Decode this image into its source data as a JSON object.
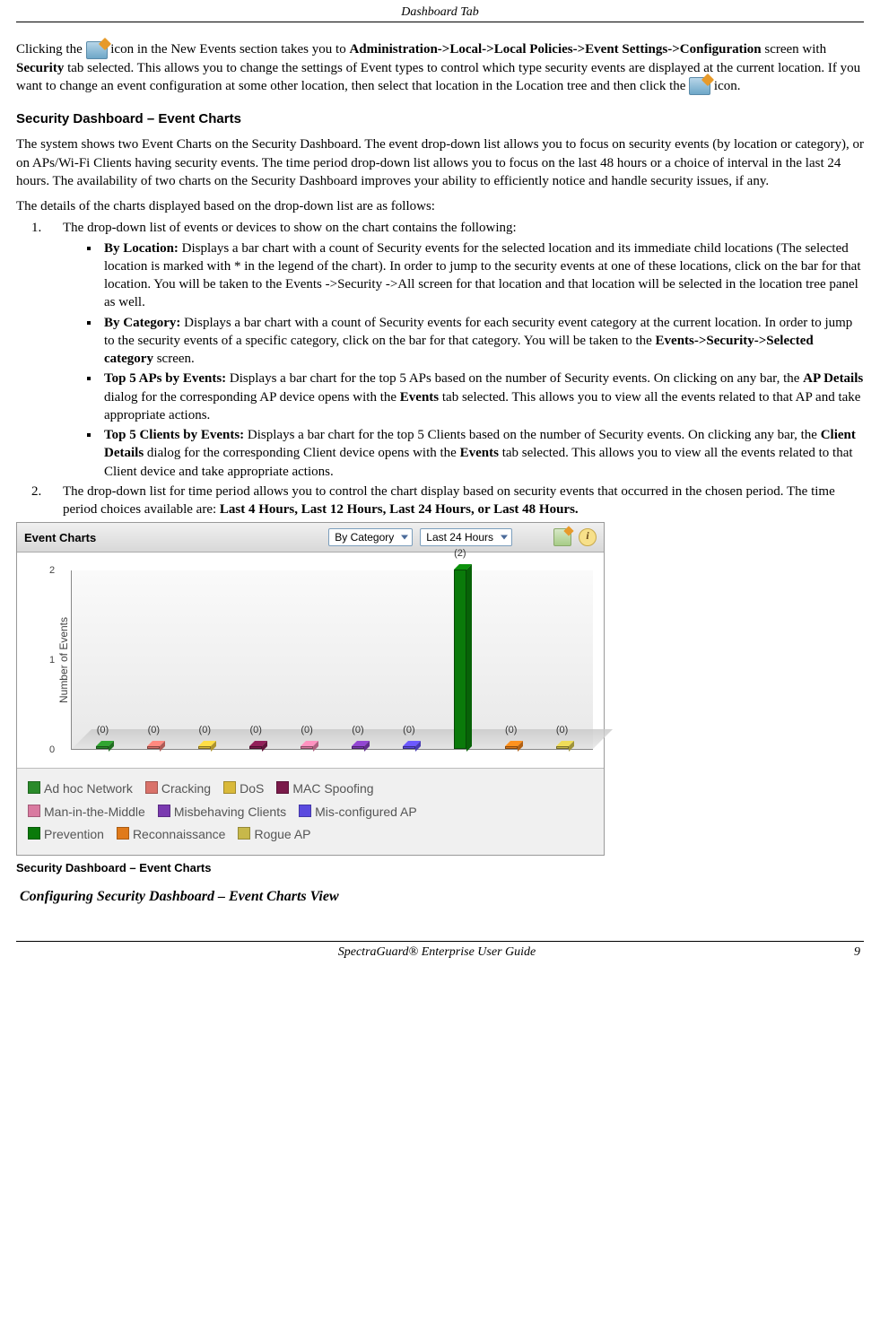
{
  "header": {
    "title": "Dashboard Tab"
  },
  "para1": {
    "lead": "Clicking the ",
    "icon_name": "locate-edit-icon",
    "after_icon": " icon in the New Events section takes you to ",
    "bold_path": "Administration->Local->Local Policies->Event Settings->Configuration",
    "mid1": " screen with ",
    "bold_security": "Security",
    "mid2": " tab selected. This allows you to change the settings of Event types to control which type security events are displayed at the current location. If you want to change an event configuration at some other location, then select that location in the Location tree and then click the ",
    "tail": " icon."
  },
  "section1_heading": "Security Dashboard – Event Charts",
  "para2": "The system shows two Event Charts on the Security Dashboard. The event drop-down list allows you to focus on security events (by location or category), or on APs/Wi-Fi Clients having security events. The time period drop-down list allows you to focus on the last 48 hours or a choice of interval in the last 24 hours. The availability of two charts on the Security Dashboard improves your ability to efficiently notice and handle security issues, if any.",
  "para3": "The details of the charts displayed based on the drop-down list are as follows:",
  "list1_item1": "The drop-down list of events or devices to show on the chart contains the following:",
  "bullets": [
    {
      "title": "By Location:",
      "text": " Displays a bar chart with a count of Security events for the selected location and its immediate child locations (The selected location is marked with * in the legend of the chart). In order to jump to the security events at one of these locations, click on the bar for that location. You will be taken to the Events ->Security ->All screen for that location and that location will be selected in the location tree panel as well."
    },
    {
      "title": "By Category:",
      "text_pre": " Displays a bar chart with a count of Security events for each security event category at the current location. In order to jump to the security events of a specific category, click on the bar for that category. You will be taken to the ",
      "bold1": "Events->Security->Selected category",
      "text_post": " screen."
    },
    {
      "title": "Top 5 APs by Events:",
      "text_pre": " Displays a bar chart for the top 5 APs based on the number of Security events. On clicking on any bar, the ",
      "bold1": "AP Details",
      "mid": " dialog for the corresponding AP device opens with the ",
      "bold2": "Events",
      "text_post": " tab selected. This allows you to view all the events related to that AP and take appropriate actions."
    },
    {
      "title": "Top 5 Clients by Events:",
      "text_pre": " Displays a bar chart for the top 5 Clients based on the number of Security events. On clicking any bar, the ",
      "bold1": "Client Details",
      "mid": " dialog for the corresponding Client device opens with the ",
      "bold2": "Events",
      "text_post": " tab selected. This allows you to view all the events related to that Client device and take appropriate actions."
    }
  ],
  "list1_item2_pre": "The drop-down list for time period allows you to control the chart display based on security events that occurred in the chosen period. The time period choices available are: ",
  "list1_item2_bold": "Last 4 Hours, Last 12 Hours, Last 24 Hours, or Last 48 Hours.",
  "chart_ui": {
    "panel_title": "Event Charts",
    "dropdown1": "By Category",
    "dropdown2": "Last 24 Hours"
  },
  "chart_data": {
    "type": "bar",
    "title": "Event Charts",
    "ylabel": "Number of Events",
    "xlabel": "",
    "ylim": [
      0,
      2
    ],
    "yticks": [
      0,
      1,
      2
    ],
    "series": [
      {
        "name": "Ad hoc Network",
        "color": "#2a8a2a",
        "value": 0
      },
      {
        "name": "Cracking",
        "color": "#d9726a",
        "value": 0
      },
      {
        "name": "DoS",
        "color": "#d9b93a",
        "value": 0
      },
      {
        "name": "MAC Spoofing",
        "color": "#7a1a4a",
        "value": 0
      },
      {
        "name": "Man-in-the-Middle",
        "color": "#d97aa0",
        "value": 0
      },
      {
        "name": "Misbehaving Clients",
        "color": "#7a3ab0",
        "value": 0
      },
      {
        "name": "Mis-configured AP",
        "color": "#5a4adf",
        "value": 0
      },
      {
        "name": "Prevention",
        "color": "#0a7a0a",
        "value": 2
      },
      {
        "name": "Reconnaissance",
        "color": "#e07a1a",
        "value": 0
      },
      {
        "name": "Rogue AP",
        "color": "#c7b84a",
        "value": 0
      }
    ]
  },
  "caption": "Security Dashboard – Event Charts",
  "subheading": "Configuring Security Dashboard – Event Charts View",
  "footer": {
    "left": "SpectraGuard® Enterprise User Guide",
    "right": "9"
  }
}
